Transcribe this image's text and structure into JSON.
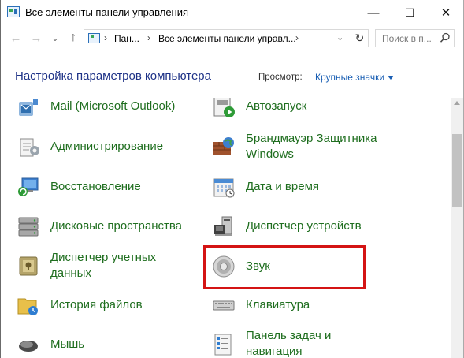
{
  "window": {
    "title": "Все элементы панели управления",
    "minimize_glyph": "—",
    "maximize_glyph": "☐",
    "close_glyph": "✕"
  },
  "nav": {
    "back_glyph": "←",
    "forward_glyph": "→",
    "dropdown_glyph": "⌄",
    "up_glyph": "↑",
    "breadcrumb": [
      "Пан...",
      "Все элементы панели управл..."
    ],
    "breadcrumb_sep": "›",
    "breadcrumb_dropdown": "⌄",
    "refresh_glyph": "↻",
    "search_placeholder": "Поиск в п..."
  },
  "header": {
    "title": "Настройка параметров компьютера",
    "view_label": "Просмотр:",
    "view_value": "Крупные значки"
  },
  "items": [
    {
      "label": "Mail (Microsoft Outlook)",
      "icon": "mail-icon"
    },
    {
      "label": "Автозапуск",
      "icon": "autoplay-icon"
    },
    {
      "label": "Администрирование",
      "icon": "admin-tools-icon"
    },
    {
      "label": "Брандмауэр Защитника Windows",
      "icon": "firewall-icon"
    },
    {
      "label": "Восстановление",
      "icon": "recovery-icon"
    },
    {
      "label": "Дата и время",
      "icon": "datetime-icon"
    },
    {
      "label": "Дисковые пространства",
      "icon": "storage-spaces-icon"
    },
    {
      "label": "Диспетчер устройств",
      "icon": "device-manager-icon"
    },
    {
      "label": "Диспетчер учетных данных",
      "icon": "credential-manager-icon"
    },
    {
      "label": "Звук",
      "icon": "sound-icon"
    },
    {
      "label": "История файлов",
      "icon": "file-history-icon"
    },
    {
      "label": "Клавиатура",
      "icon": "keyboard-icon"
    },
    {
      "label": "Мышь",
      "icon": "mouse-icon"
    },
    {
      "label": "Панель задач и навигация",
      "icon": "taskbar-icon"
    }
  ],
  "colors": {
    "item_text": "#1f6e1f",
    "title_text": "#1e3287",
    "link": "#1a5fb4",
    "highlight": "#d41414"
  }
}
